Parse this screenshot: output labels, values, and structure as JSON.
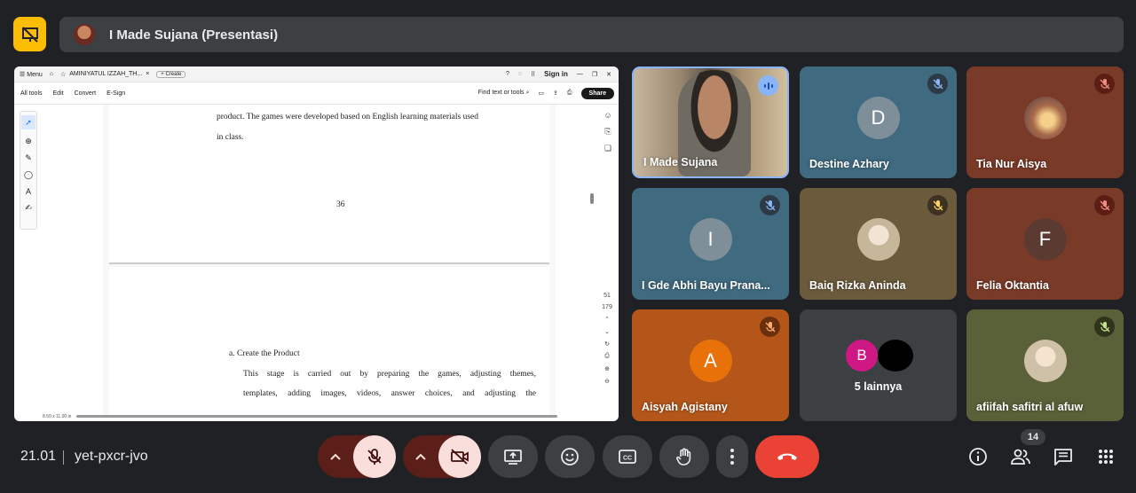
{
  "top": {
    "presenter_title": "I Made Sujana (Presentasi)"
  },
  "shared_screen": {
    "titlebar": {
      "menu": "Menu",
      "tab": "AMINIYATUL IZZAH_TH...",
      "create": "Create",
      "signin": "Sign in"
    },
    "menubar": {
      "items": [
        "All tools",
        "Edit",
        "Convert",
        "E-Sign"
      ],
      "find": "Find text or tools",
      "share": "Share"
    },
    "page1": {
      "line1": "product. The games were developed based on English learning materials used",
      "line2": "in class.",
      "page_number": "36"
    },
    "page2": {
      "heading": "a.    Create the Product",
      "line1": "This stage is carried out by preparing the games, adjusting themes,",
      "line2": "templates, adding images, videos, answer choices, and adjusting the"
    },
    "nav": {
      "current_page": "51",
      "total_pages": "179"
    },
    "status": {
      "page_size": "8.50 x 11.00 in"
    }
  },
  "participants": [
    {
      "name": "I Made Sujana",
      "initial": "",
      "speaking": true
    },
    {
      "name": "Destine Azhary",
      "initial": "D",
      "muted": true
    },
    {
      "name": "Tia Nur Aisya",
      "initial": "",
      "muted": true
    },
    {
      "name": "I Gde Abhi Bayu Prana...",
      "initial": "I",
      "muted": true
    },
    {
      "name": "Baiq Rizka Aninda",
      "initial": "",
      "muted": true
    },
    {
      "name": "Felia Oktantia",
      "initial": "F",
      "muted": true
    },
    {
      "name": "Aisyah Agistany",
      "initial": "A",
      "muted": true
    },
    {
      "name": "5 lainnya",
      "initial": "B"
    },
    {
      "name": "afiifah safitri al afuw",
      "initial": "",
      "muted": true
    }
  ],
  "bottom": {
    "time": "21.01",
    "meeting_code": "yet-pxcr-jvo",
    "participant_count": "14"
  },
  "colors": {
    "background": "#202124",
    "tile_blue": "#3f6a80",
    "tile_brown": "#7a3a28",
    "tile_orange": "#b4561a",
    "end_call": "#ea4335",
    "accent_yellow": "#fbbc04"
  }
}
